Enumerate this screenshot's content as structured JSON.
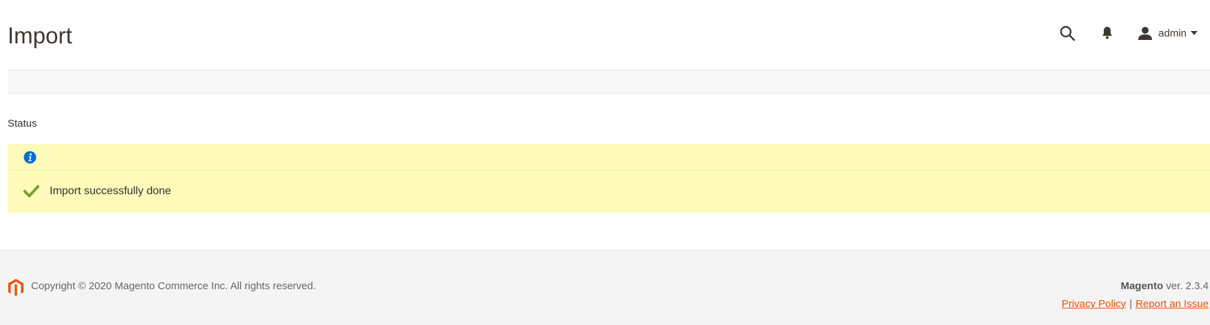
{
  "header": {
    "title": "Import",
    "icons": {
      "search": "search-icon",
      "notifications": "bell-icon",
      "user": "user-icon",
      "caret": "caret-down-icon"
    },
    "user_name": "admin"
  },
  "status": {
    "section_title": "Status",
    "info_icon": "info-icon",
    "success_icon": "checkmark-icon",
    "success_message": "Import successfully done",
    "background_color": "#fffbbb"
  },
  "footer": {
    "logo": "magento-logo",
    "copyright": "Copyright © 2020 Magento Commerce Inc. All rights reserved.",
    "brand": "Magento",
    "version": " ver. 2.3.4",
    "privacy_link": "Privacy Policy",
    "separator": "|",
    "report_link": "Report an Issue",
    "link_color": "#eb5202"
  }
}
